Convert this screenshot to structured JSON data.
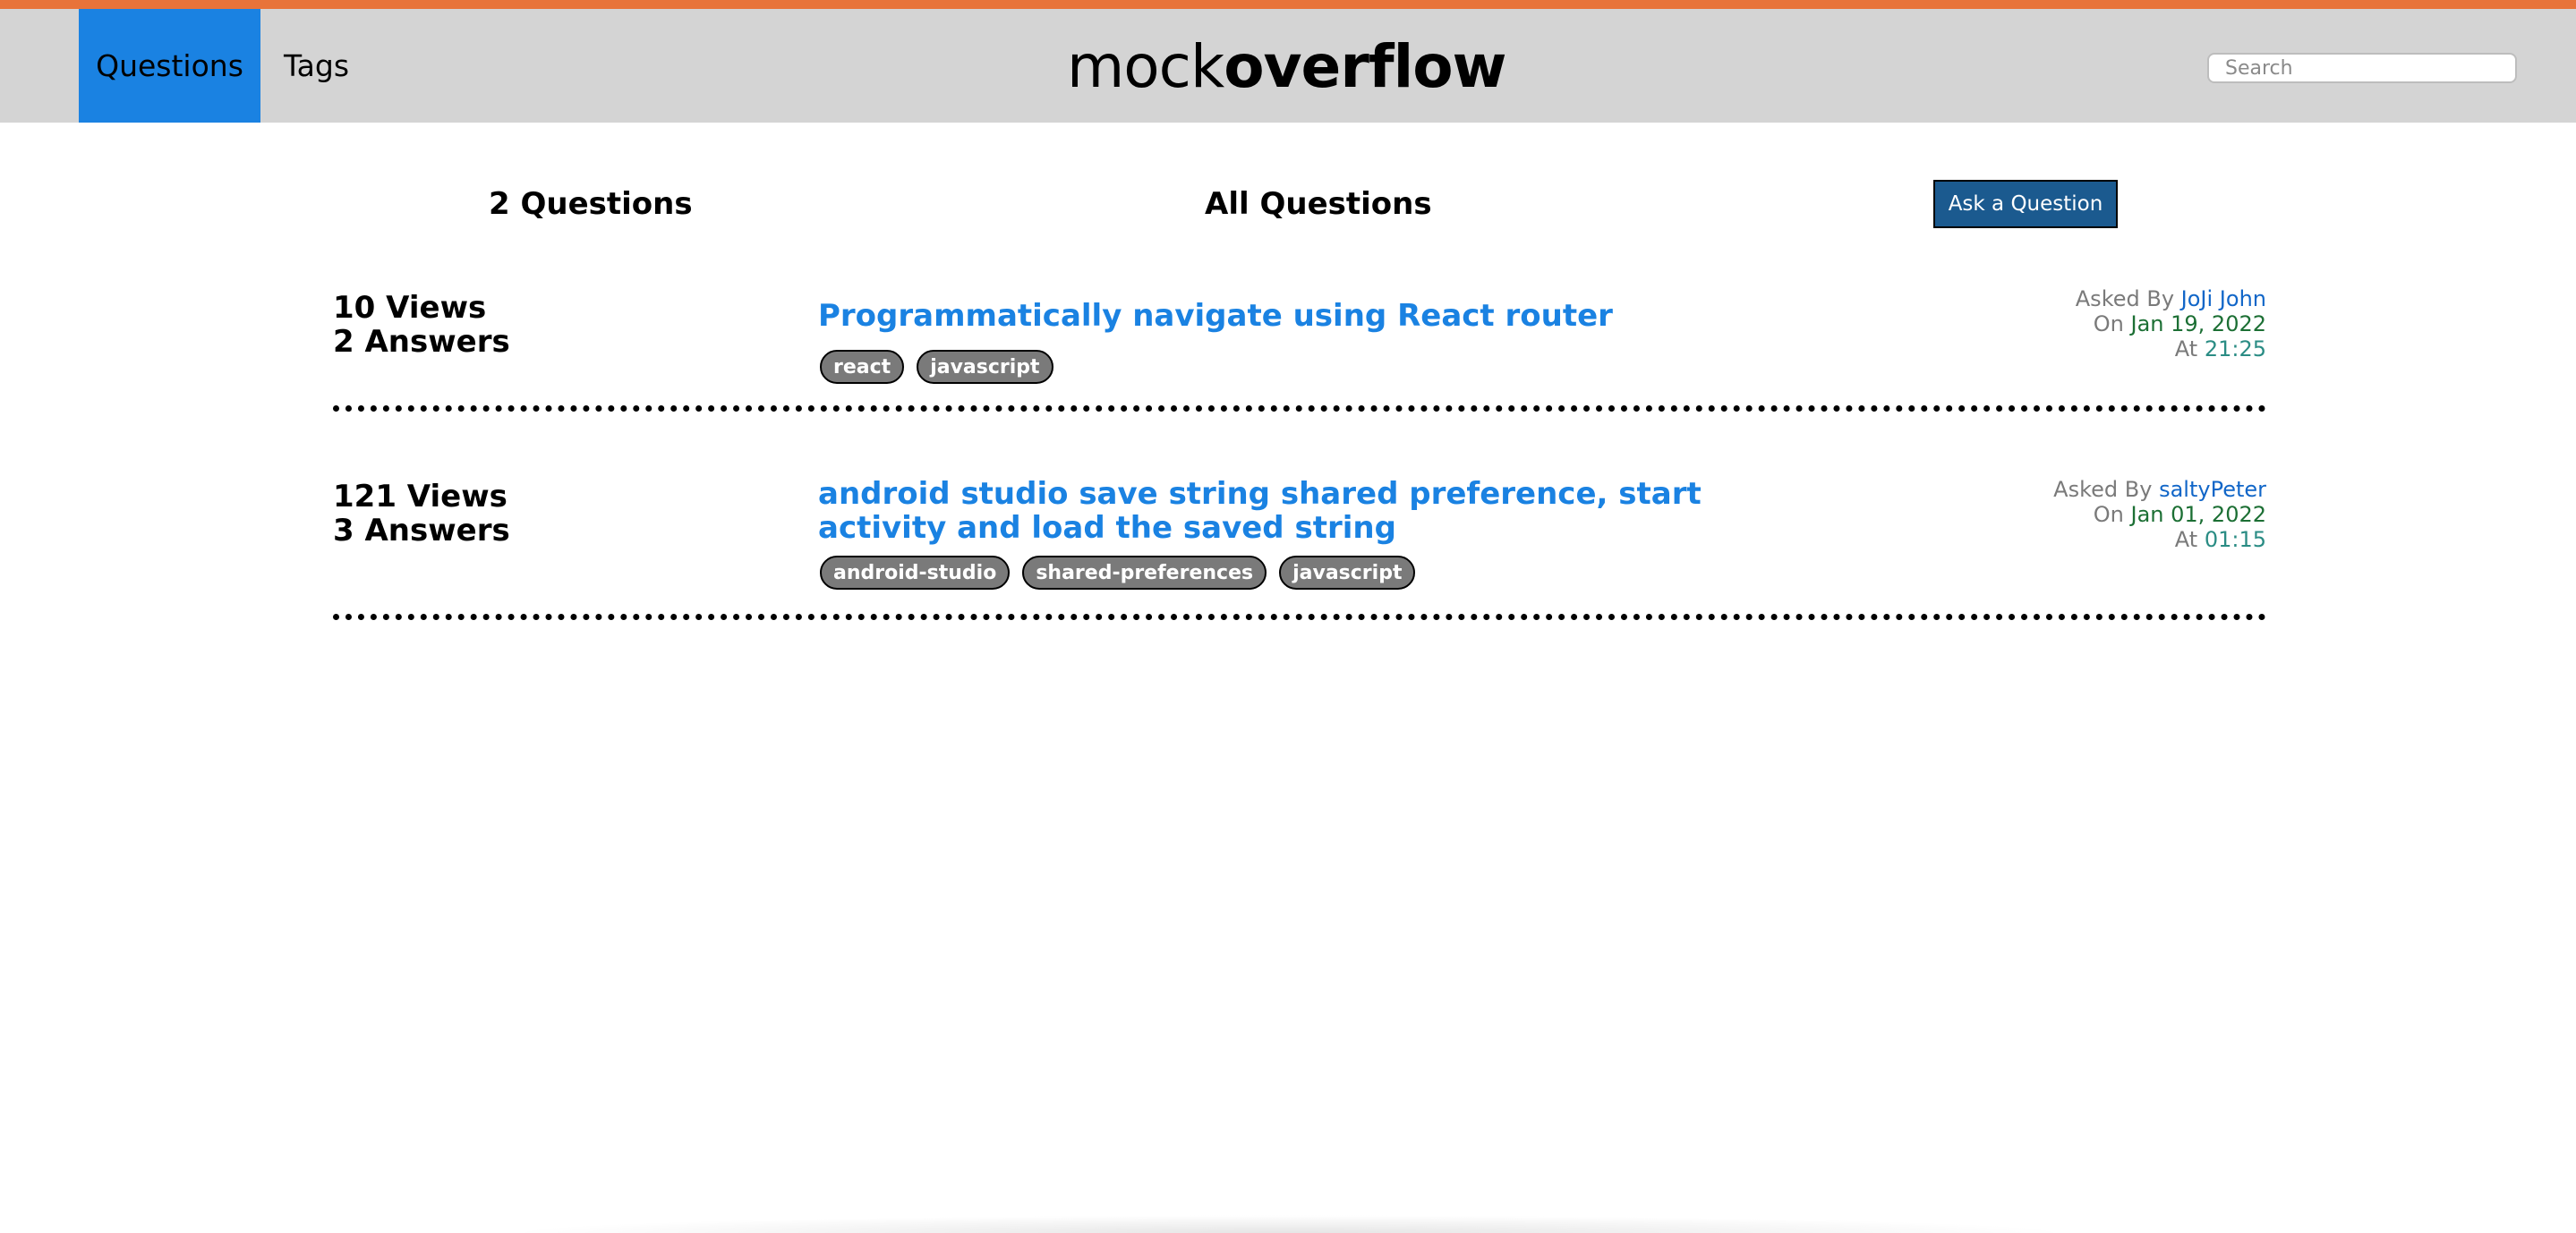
{
  "header": {
    "nav": [
      {
        "label": "Questions",
        "active": true
      },
      {
        "label": "Tags",
        "active": false
      }
    ],
    "logo_light": "mock",
    "logo_bold": "overflow",
    "search_placeholder": "Search",
    "accent_color": "#e8733a",
    "active_tab_color": "#1a82e2"
  },
  "main": {
    "question_count": "2 Questions",
    "heading": "All Questions",
    "ask_button": "Ask a Question"
  },
  "questions": [
    {
      "views": "10 Views",
      "answers": "2 Answers",
      "title": "Programmatically navigate using React router",
      "tags": [
        "react",
        "javascript"
      ],
      "asked_by_label": "Asked By",
      "author": "JoJi John",
      "on_label": "On",
      "date": "Jan 19, 2022",
      "at_label": "At",
      "time": "21:25"
    },
    {
      "views": "121 Views",
      "answers": "3 Answers",
      "title": "android studio save string shared preference, start activity and load the saved string",
      "tags": [
        "android-studio",
        "shared-preferences",
        "javascript"
      ],
      "asked_by_label": "Asked By",
      "author": "saltyPeter",
      "on_label": "On",
      "date": "Jan 01, 2022",
      "at_label": "At",
      "time": "01:15"
    }
  ]
}
